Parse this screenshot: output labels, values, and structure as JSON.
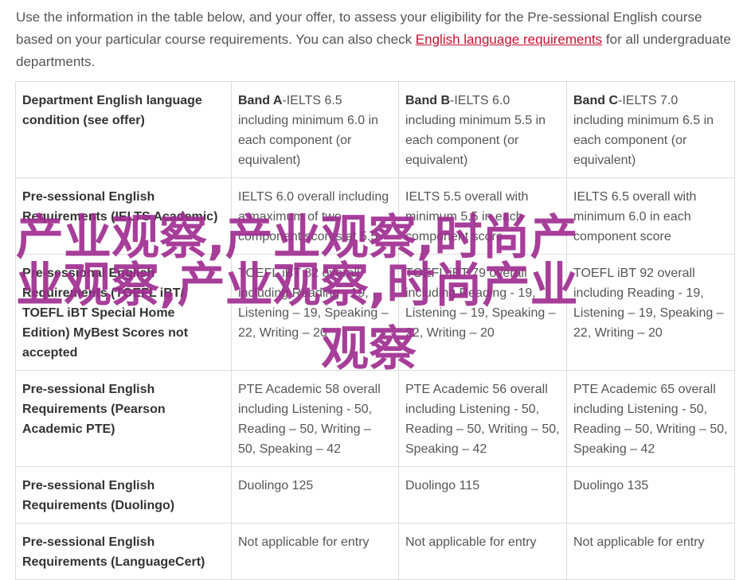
{
  "intro": {
    "text_before": "Use the information in the table below, and your offer, to assess your eligibility for the Pre-sessional English course based on your particular course requirements. You can also check ",
    "link": "English language requirements",
    "text_after": " for all undergraduate departments."
  },
  "table": {
    "header": {
      "label": "Department English language condition (see offer)",
      "bands": [
        {
          "name": "Band A",
          "detail": "-IELTS 6.5 including minimum 6.0 in each component (or equivalent)"
        },
        {
          "name": "Band B",
          "detail": "-IELTS 6.0 including minimum 5.5 in each component (or equivalent)"
        },
        {
          "name": "Band C",
          "detail": "-IELTS 7.0 including minimum 6.5 in each component (or equivalent)"
        }
      ]
    },
    "rows": [
      {
        "label": "Pre-sessional English Requirements (IELTS Academic)",
        "cells": [
          "IELTS 6.0 overall including a maximum of two component scores at 5.5",
          "IELTS 5.5 overall with minimum 5.5 in each component score",
          "IELTS 6.5 overall with minimum 6.0 in each component score"
        ]
      },
      {
        "label": "Pre-sessional English Requirements (TOEFL iBT/ TOEFL iBT Special Home Edition) MyBest Scores not accepted",
        "cells": [
          "TOEFL iBT 82 overall including Reading - 19, Listening – 19, Speaking – 22, Writing – 20",
          "TOEFL iBT 79 overall including Reading - 19, Listening – 19, Speaking – 22, Writing – 20",
          "TOEFL iBT 92 overall including Reading - 19, Listening – 19, Speaking – 22, Writing – 20"
        ]
      },
      {
        "label": "Pre-sessional English Requirements (Pearson Academic PTE)",
        "cells": [
          "PTE Academic 58 overall including Listening - 50, Reading – 50, Writing – 50, Speaking – 42",
          "PTE Academic 56 overall including Listening - 50, Reading – 50, Writing – 50, Speaking – 42",
          "PTE Academic 65 overall including Listening - 50, Reading – 50, Writing – 50, Speaking – 42"
        ]
      },
      {
        "label": "Pre-sessional English Requirements (Duolingo)",
        "cells": [
          "Duolingo 125",
          "Duolingo 115",
          "Duolingo 135"
        ]
      },
      {
        "label": "Pre-sessional English Requirements (LanguageCert)",
        "cells": [
          "Not applicable for entry",
          "Not applicable for entry",
          "Not applicable for entry"
        ]
      }
    ]
  },
  "watermark": {
    "line1": "产业观察,产业观察,时尚产",
    "line2": "业观察,产业观察,时尚产业",
    "line3": "观察",
    "color": "#9e2a8e"
  },
  "colors": {
    "link": "#c8102e",
    "border": "#dcdcdc",
    "text": "#555555"
  }
}
